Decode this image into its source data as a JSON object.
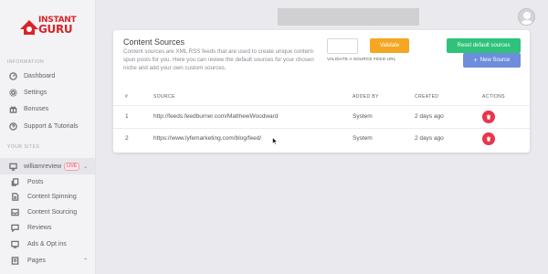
{
  "brand": {
    "line1": "INSTANT",
    "line2": "GURU"
  },
  "sidebar": {
    "section_information": "INFORMATION",
    "section_sites": "YOUR SITES",
    "items": [
      {
        "label": "Dashboard",
        "icon": "dashboard-icon"
      },
      {
        "label": "Settings",
        "icon": "gear-icon"
      },
      {
        "label": "Bonuses",
        "icon": "gift-icon"
      },
      {
        "label": "Support & Tutorials",
        "icon": "help-circle-icon"
      }
    ],
    "site": {
      "name": "williamreview",
      "badge": "LIVE",
      "icon": "monitor-icon"
    },
    "site_items": [
      {
        "label": "Posts",
        "icon": "copy-icon"
      },
      {
        "label": "Content Spinning",
        "icon": "document-icon"
      },
      {
        "label": "Content Sourcing",
        "icon": "inbox-icon"
      },
      {
        "label": "Reviews",
        "icon": "chat-icon"
      },
      {
        "label": "Ads & Opt ins",
        "icon": "ads-icon"
      },
      {
        "label": "Pages",
        "icon": "pages-icon"
      }
    ]
  },
  "main": {
    "title": "Content Sources",
    "description": "Content sources are XML RSS feeds that are used to create unique content-spun posts for you. Here you can review the default sources for your chosen niche and add your own custom sources.",
    "feed_input": {
      "value": "",
      "placeholder": ""
    },
    "feed_help": "VALIDATE A SOURCE FEED URL",
    "validate_label": "Validate",
    "reset_label": "Reset default sources",
    "new_source_label": "New Source",
    "columns": [
      "#",
      "SOURCE",
      "ADDED BY",
      "CREATED",
      "ACTIONS"
    ],
    "rows": [
      {
        "num": "1",
        "source": "http://feeds.feedburner.com/MatthewWoodward",
        "added_by": "System",
        "created": "2 days ago"
      },
      {
        "num": "2",
        "source": "https://www.lyfemarketing.com/blog/feed/",
        "added_by": "System",
        "created": "2 days ago"
      }
    ]
  },
  "colors": {
    "brand_red": "#d9252a",
    "validate": "#f5a623",
    "reset": "#2ec27a",
    "new_source": "#6e8ddb",
    "delete": "#e8364e"
  }
}
